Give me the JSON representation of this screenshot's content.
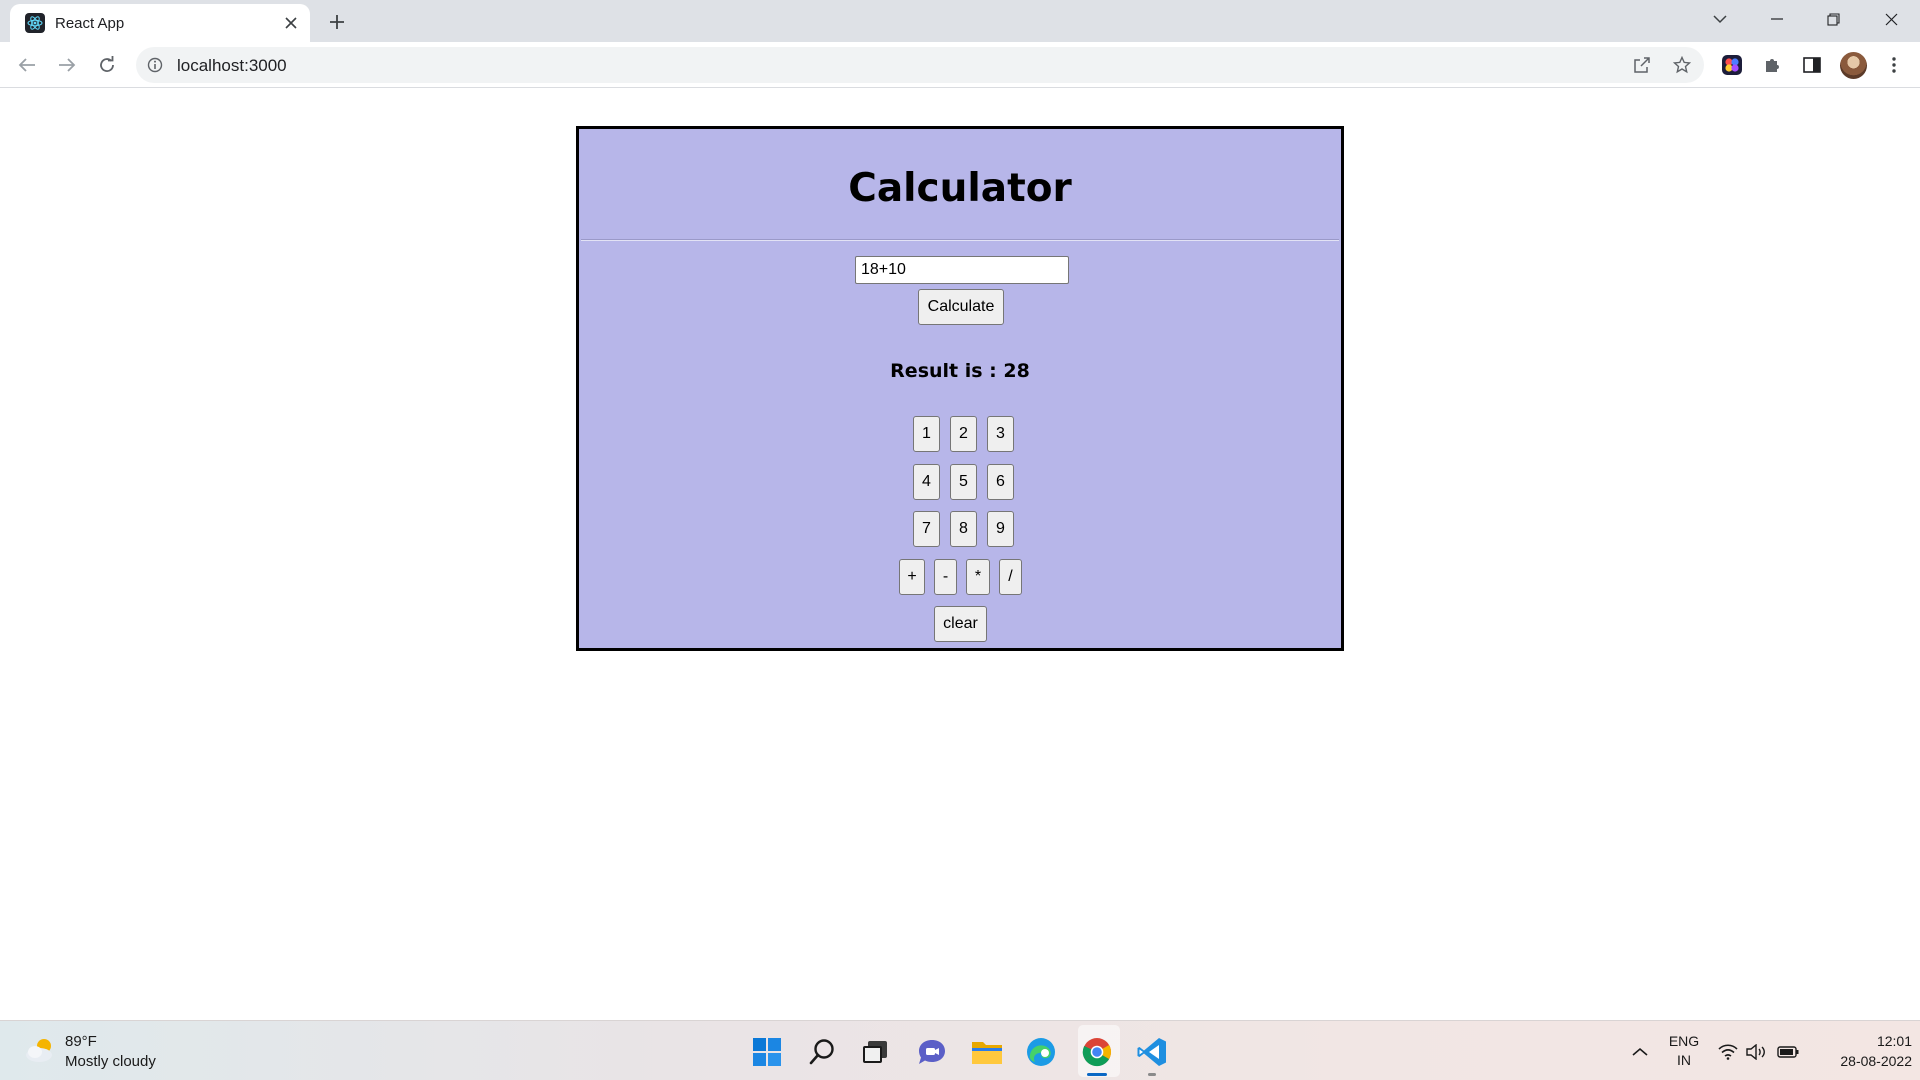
{
  "browser": {
    "tab": {
      "title": "React App",
      "favicon": "react-atom-icon"
    },
    "address": {
      "url": "localhost:3000"
    },
    "icons": [
      "back-arrow-icon",
      "forward-arrow-icon",
      "reload-icon",
      "info-icon",
      "share-icon",
      "star-icon",
      "extension-app-icon",
      "puzzle-icon",
      "side-panel-icon",
      "kebab-menu-icon"
    ]
  },
  "calculator": {
    "title": "Calculator",
    "input": {
      "value": "18+10",
      "placeholder": ""
    },
    "calculate_label": "Calculate",
    "result_text": "Result is : 28",
    "digit_rows": [
      [
        "1",
        "2",
        "3"
      ],
      [
        "4",
        "5",
        "6"
      ],
      [
        "7",
        "8",
        "9"
      ]
    ],
    "operators": [
      "+",
      "-",
      "*",
      "/"
    ],
    "clear_label": "clear",
    "colors": {
      "panel_bg": "#b7b6e9",
      "border": "#000000",
      "button_bg": "#efefef"
    }
  },
  "taskbar": {
    "weather": {
      "temp": "89°F",
      "desc": "Mostly cloudy"
    },
    "apps": [
      "windows-start-icon",
      "search-icon",
      "task-view-icon",
      "teams-chat-icon",
      "file-explorer-icon",
      "edge-browser-icon",
      "chrome-browser-icon",
      "vscode-icon"
    ],
    "tray": {
      "lang_top": "ENG",
      "lang_bottom": "IN",
      "time": "12:01",
      "date": "28-08-2022"
    }
  }
}
